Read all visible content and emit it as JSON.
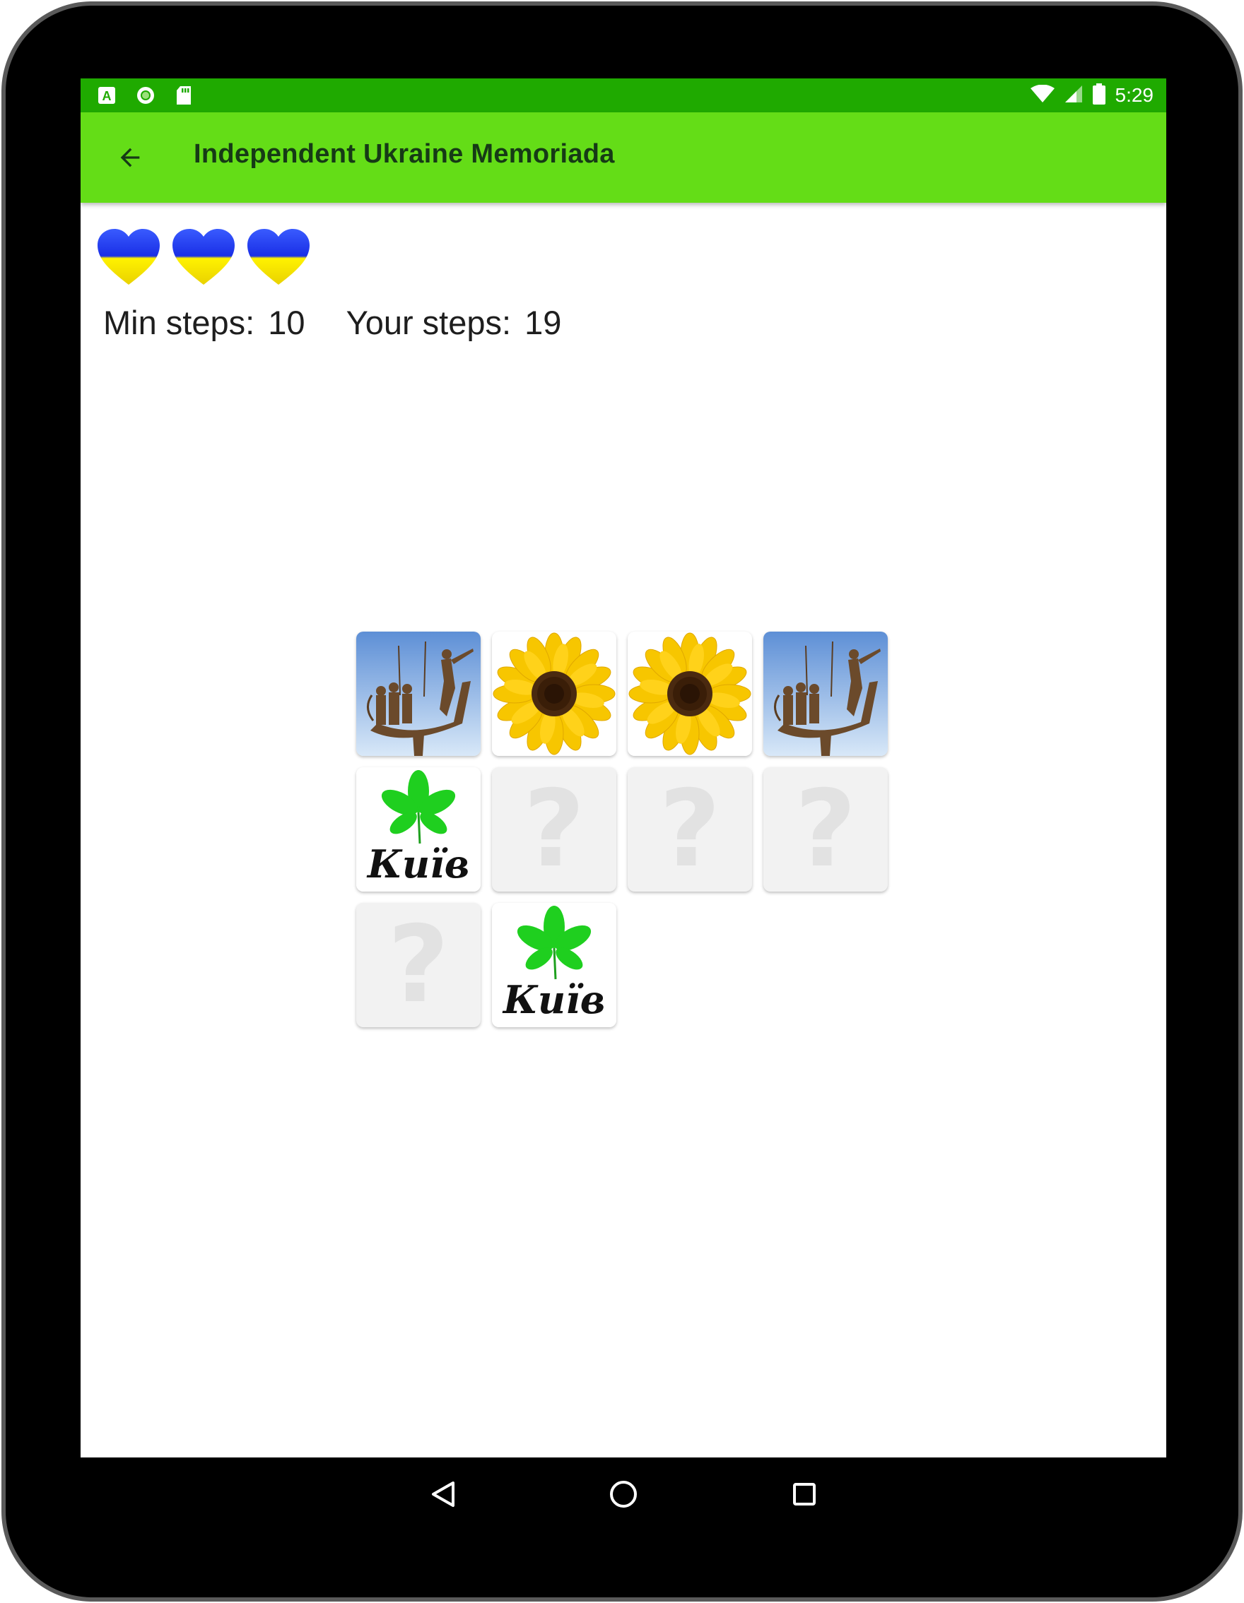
{
  "statusbar": {
    "time": "5:29",
    "left_icons": [
      "a-notification-icon",
      "circle-notification-icon",
      "sd-card-icon"
    ],
    "right_icons": [
      "wifi-icon",
      "signal-icon",
      "battery-icon"
    ]
  },
  "appbar": {
    "title": "Independent Ukraine Memoriada",
    "back_icon": "arrow-back-icon"
  },
  "lives": {
    "count": 3,
    "icon": "ukraine-heart-icon",
    "colors": {
      "top": "#1a3cf0",
      "bottom": "#f7e300"
    }
  },
  "steps": {
    "min_label": "Min steps:",
    "min_value": "10",
    "your_label": "Your steps:",
    "your_value": "19"
  },
  "board": {
    "hidden_symbol": "?",
    "cards": [
      {
        "state": "revealed",
        "image": "kyiv-founders-monument"
      },
      {
        "state": "revealed",
        "image": "sunflower"
      },
      {
        "state": "revealed",
        "image": "sunflower"
      },
      {
        "state": "revealed",
        "image": "kyiv-founders-monument"
      },
      {
        "state": "revealed",
        "image": "kyiv-chestnut-leaf-logo",
        "text": "Київ"
      },
      {
        "state": "hidden"
      },
      {
        "state": "hidden"
      },
      {
        "state": "hidden"
      },
      {
        "state": "hidden"
      },
      {
        "state": "revealed",
        "image": "kyiv-chestnut-leaf-logo",
        "text": "Київ"
      }
    ]
  },
  "navbar": {
    "back": "nav-back-icon",
    "home": "nav-home-icon",
    "recents": "nav-recents-icon"
  },
  "colors": {
    "statusbar": "#1faa00",
    "appbar": "#64dd17",
    "card_hidden": "#f2f2f2"
  }
}
